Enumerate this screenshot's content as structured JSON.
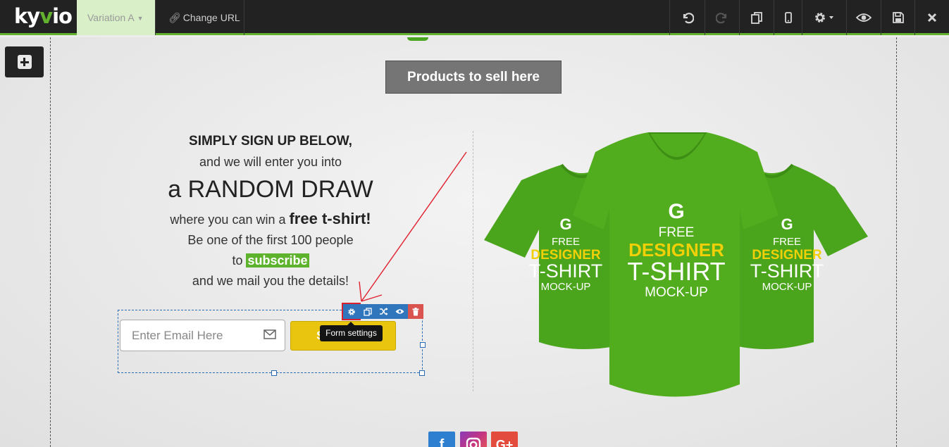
{
  "topbar": {
    "logo": {
      "text_a": "ky",
      "text_v": "v",
      "text_b": "io"
    },
    "variation_label": "Variation A",
    "change_url_label": "Change URL",
    "icons": [
      "undo-icon",
      "redo-icon",
      "duplicate-pages-icon",
      "mobile-preview-icon",
      "settings-icon",
      "preview-eye-icon",
      "save-icon",
      "close-icon"
    ]
  },
  "canvas": {
    "products_button": "Products to sell here",
    "copy": {
      "line1": "SIMPLY SIGN UP BELOW,",
      "line2": "and we will enter you into",
      "line3": "a RANDOM DRAW",
      "line4_pre": "where you can win a ",
      "line4_bold": "free t-shirt!",
      "line5": "Be one of the first 100 people",
      "line6_pre": "to ",
      "line6_highlight": "subscribe",
      "line7": "and we mail you the details!"
    },
    "form": {
      "email_placeholder": "Enter Email Here",
      "submit_label": "S",
      "tooltip": "Form settings",
      "toolbar_icons": [
        "gear-icon",
        "copy-icon",
        "shuffle-icon",
        "eye-icon",
        "trash-icon"
      ]
    },
    "shirt_print": {
      "line1": "FREE",
      "line2": "DESIGNER",
      "line3": "T-SHIRT",
      "line4": "MOCK-UP"
    },
    "social": {
      "facebook": "f",
      "google_plus": "G+"
    }
  },
  "colors": {
    "accent_green": "#62b12f",
    "shirt_green": "#52ad1e",
    "submit_yellow": "#e9c510",
    "editor_blue": "#2f76bd",
    "delete_red": "#d9534f",
    "annotation_red": "#e0202e"
  }
}
